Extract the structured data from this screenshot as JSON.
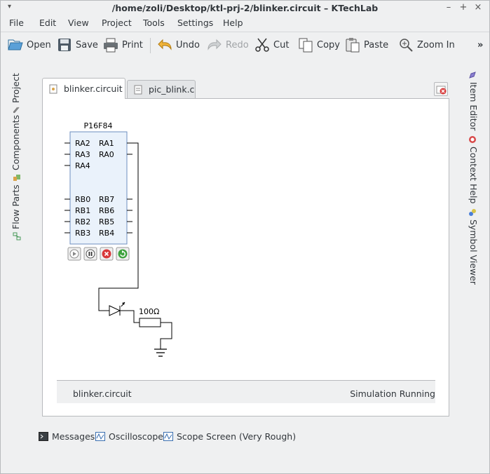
{
  "window": {
    "title": "/home/zoli/Desktop/ktl-prj-2/blinker.circuit – KTechLab",
    "menu_arrow": "▾",
    "minimize": "–",
    "maximize": "+",
    "close": "×"
  },
  "menu": {
    "items": [
      {
        "label": "File"
      },
      {
        "label": "Edit"
      },
      {
        "label": "View"
      },
      {
        "label": "Project"
      },
      {
        "label": "Tools"
      },
      {
        "label": "Settings"
      },
      {
        "label": "Help"
      }
    ]
  },
  "toolbar": {
    "open": "Open",
    "save": "Save",
    "print": "Print",
    "undo": "Undo",
    "redo": "Redo",
    "cut": "Cut",
    "copy": "Copy",
    "paste": "Paste",
    "zoom_in": "Zoom In",
    "overflow": "»"
  },
  "left_dock": {
    "tabs": [
      "Project",
      "Components",
      "Flow Parts"
    ]
  },
  "right_dock": {
    "tabs": [
      "Item Editor",
      "Context Help",
      "Symbol Viewer"
    ]
  },
  "documents": {
    "tabs": [
      {
        "label": "blinker.circuit",
        "active": true
      },
      {
        "label": "pic_blink.c",
        "active": false
      }
    ]
  },
  "circuit": {
    "chip_name": "P16F84",
    "left_pins": [
      "RA2",
      "RA3",
      "RA4",
      "RB0",
      "RB1",
      "RB2",
      "RB3"
    ],
    "right_pins": [
      "RA1",
      "RA0",
      "RB7",
      "RB6",
      "RB5",
      "RB4"
    ],
    "resistor_label": "100Ω"
  },
  "status": {
    "file": "blinker.circuit",
    "state": "Simulation Running"
  },
  "bottom_dock": {
    "tabs": [
      "Messages",
      "Oscilloscope",
      "Scope Screen (Very Rough)"
    ]
  },
  "colors": {
    "accent": "#3daee9",
    "chip_fill": "#eaf2fb",
    "chip_border": "#6c8ebf"
  }
}
